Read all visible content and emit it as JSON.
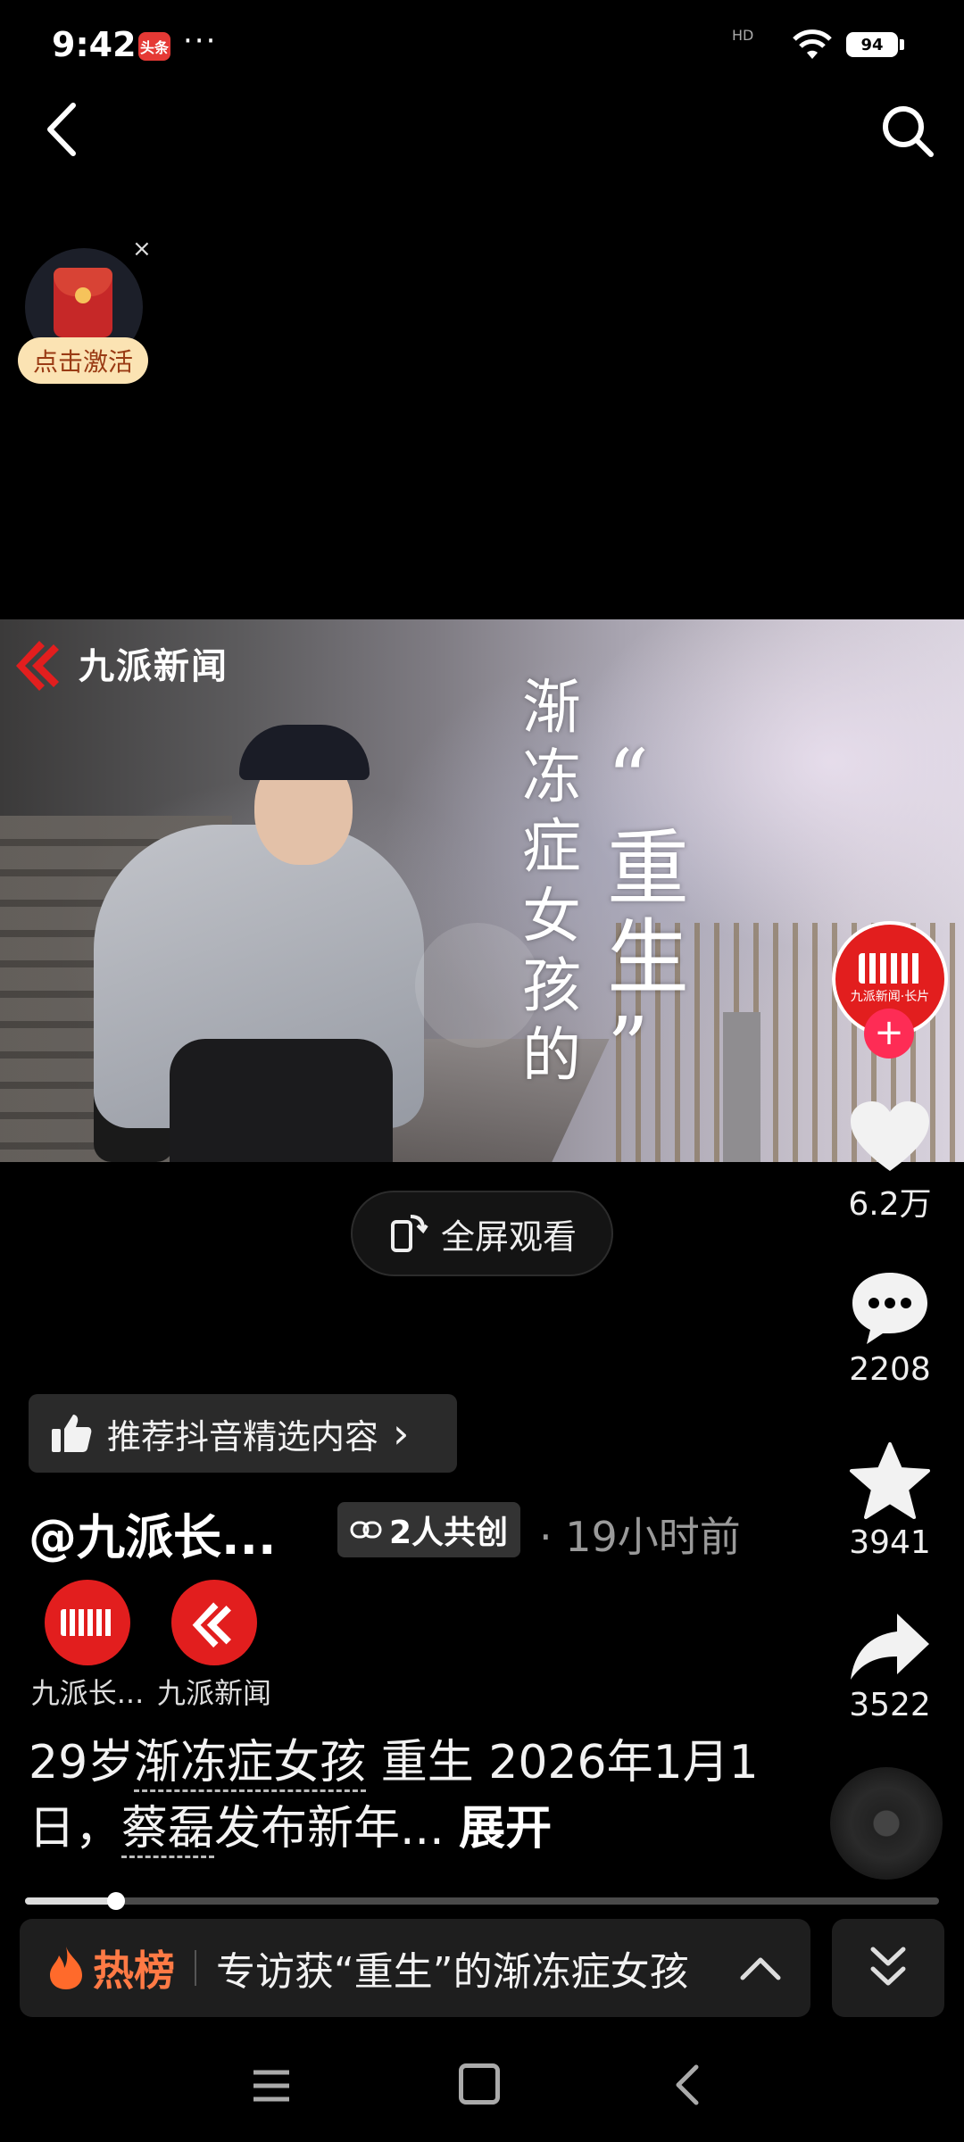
{
  "status_bar": {
    "time": "9:42",
    "app_badge": "头条",
    "dots": "···",
    "network": "HD",
    "battery": "94"
  },
  "video": {
    "channel_name": "九派新闻",
    "overlay_col1": [
      "渐",
      "冻",
      "症",
      "女",
      "孩",
      "的"
    ],
    "overlay_col2": [
      "“",
      "重",
      "生",
      "”"
    ]
  },
  "envelope": {
    "label": "点击激活",
    "close": "×"
  },
  "fullscreen": {
    "label": "全屏观看"
  },
  "rail": {
    "author_avatar_text": "九派新闻·长片",
    "follow": "+",
    "likes": "6.2万",
    "comments": "2208",
    "favorites": "3941",
    "shares": "3522"
  },
  "recommend": {
    "label": "推荐抖音精选内容",
    "arrow": "›"
  },
  "post": {
    "author_handle": "@九派长...",
    "cocreate": "2人共创",
    "time_ago": "· 19小时前",
    "coauthors": [
      {
        "name": "九派长..."
      },
      {
        "name": "九派新闻"
      }
    ],
    "desc_prefix": "29岁",
    "topic1": "渐冻症女孩",
    "desc_mid": " 重生 2026年1月1日，",
    "topic2": "蔡磊",
    "desc_suffix": "发布新年...",
    "expand": "展开"
  },
  "progress": {
    "fraction": 0.1
  },
  "hot": {
    "label": "热榜",
    "title": "专访获“重生”的渐冻症女孩"
  },
  "colors": {
    "accent": "#fe2c55",
    "hot": "#ff7a45",
    "brand_red": "#e21e1e"
  }
}
